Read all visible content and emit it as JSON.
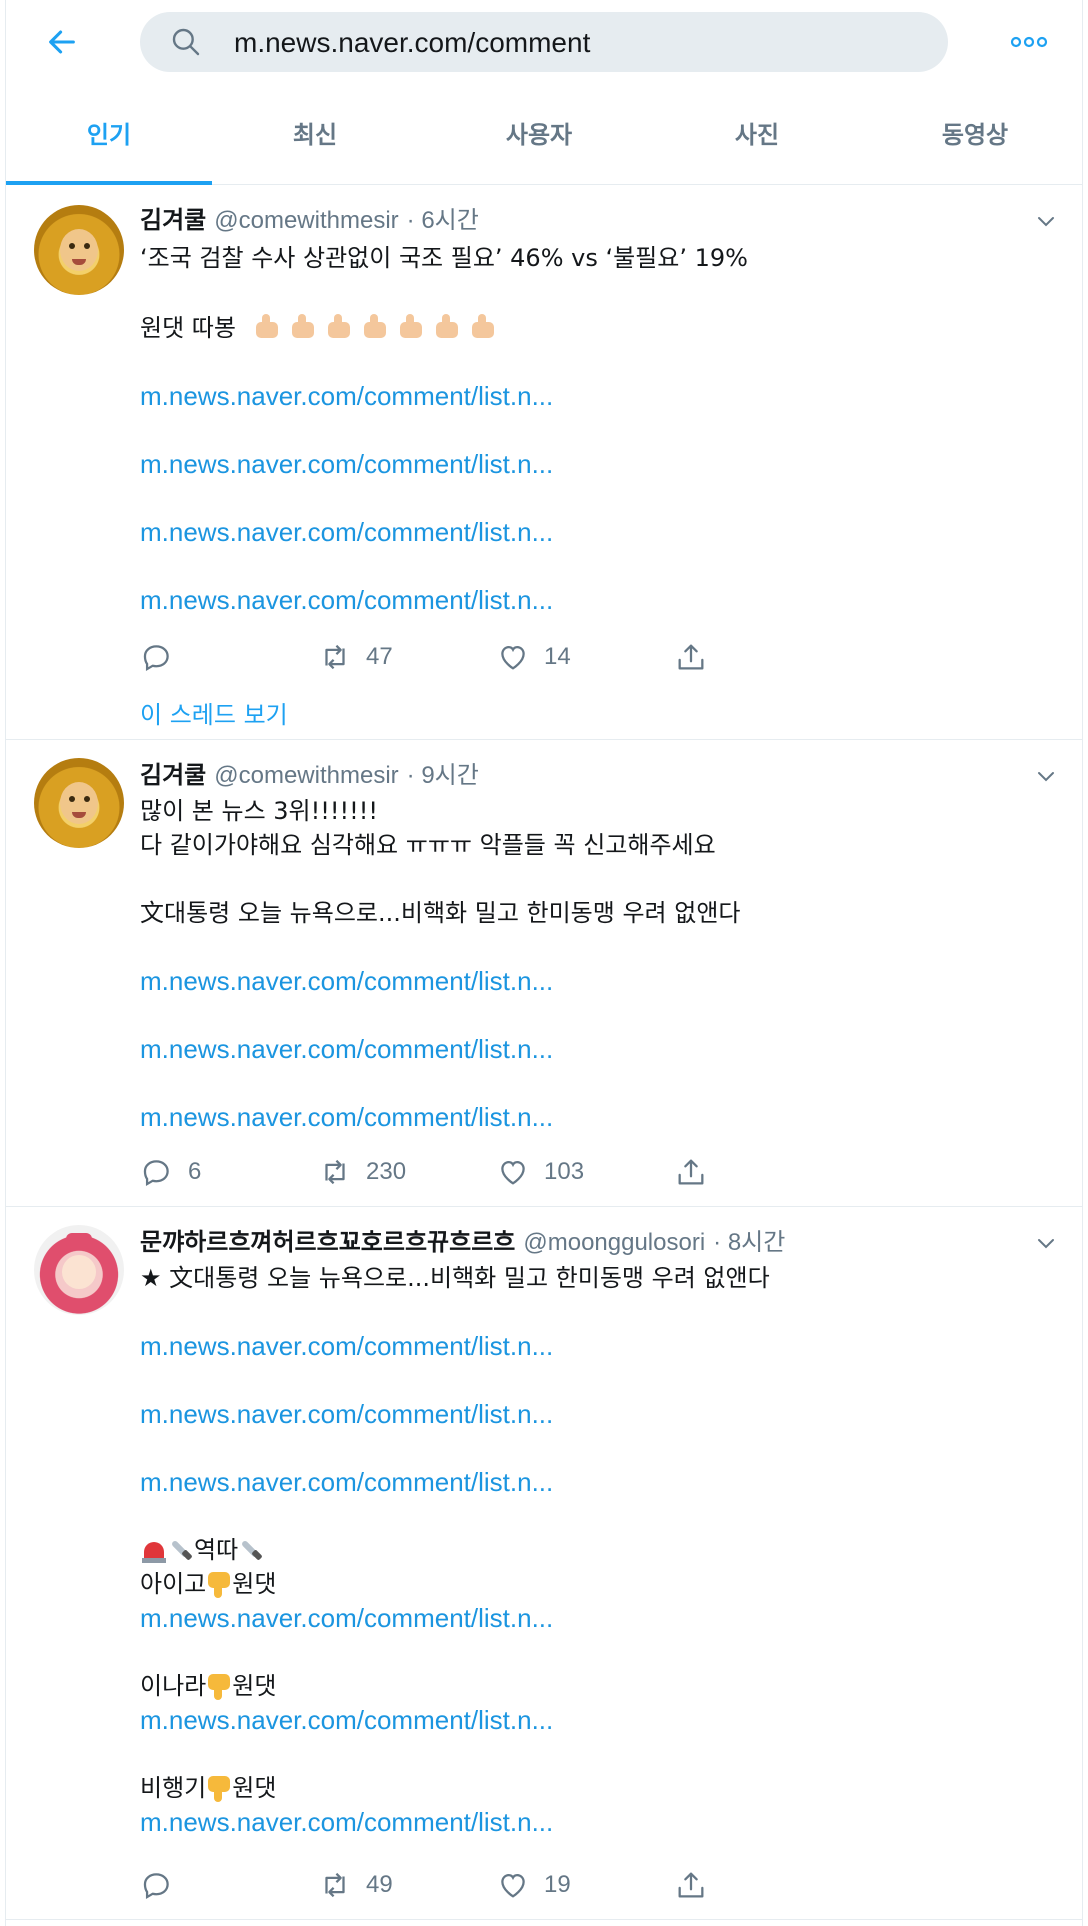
{
  "search": {
    "value": "m.news.naver.com/comment"
  },
  "tabs": [
    {
      "label": "인기",
      "active": true
    },
    {
      "label": "최신"
    },
    {
      "label": "사용자"
    },
    {
      "label": "사진"
    },
    {
      "label": "동영상"
    }
  ],
  "colors": {
    "accent": "#1da1f2",
    "link": "#1b95e0",
    "muted": "#657786",
    "border": "#e6ecf0"
  },
  "tweets": [
    {
      "name": "김겨쿨",
      "handle": "@comewithmesir",
      "time": "· 6시간",
      "text1": "‘조국 검찰 수사 상관없이 국조 필요’ 46% vs ‘불필요’ 19%",
      "text2": "원댓 따봉",
      "thumbs_emoji_count": 7,
      "links": [
        "m.news.naver.com/comment/list.n...",
        "m.news.naver.com/comment/list.n...",
        "m.news.naver.com/comment/list.n...",
        "m.news.naver.com/comment/list.n..."
      ],
      "reply_count": "",
      "retweet_count": "47",
      "like_count": "14",
      "thread_label": "이 스레드 보기"
    },
    {
      "name": "김겨쿨",
      "handle": "@comewithmesir",
      "time": "· 9시간",
      "text1": "많이 본 뉴스 3위!!!!!!!",
      "text2": "다 같이가야해요 심각해요 ㅠㅠㅠ 악플들 꼭 신고해주세요",
      "text3": "文대통령 오늘 뉴욕으로...비핵화 밀고 한미동맹 우려 없앤다",
      "links": [
        "m.news.naver.com/comment/list.n...",
        "m.news.naver.com/comment/list.n...",
        "m.news.naver.com/comment/list.n..."
      ],
      "reply_count": "6",
      "retweet_count": "230",
      "like_count": "103"
    },
    {
      "name": "문꺄하르흐껴허르흐꾜호르흐뀨흐르흐",
      "handle": "@moonggulosori",
      "time": "· 8시간",
      "text1": "★ 文대통령 오늘 뉴욕으로...비핵화 밀고 한미동맹 우려 없앤다",
      "links": [
        "m.news.naver.com/comment/list.n...",
        "m.news.naver.com/comment/list.n...",
        "m.news.naver.com/comment/list.n..."
      ],
      "siren_line": "역따",
      "group1_prefix": "아이고",
      "group1_suffix": "원댓",
      "group1_link": "m.news.naver.com/comment/list.n...",
      "group2_prefix": "이나라",
      "group2_suffix": "원댓",
      "group2_link": "m.news.naver.com/comment/list.n...",
      "group3_prefix": "비행기",
      "group3_suffix": "원댓",
      "group3_link": "m.news.naver.com/comment/list.n...",
      "reply_count": "",
      "retweet_count": "49",
      "like_count": "19"
    }
  ]
}
